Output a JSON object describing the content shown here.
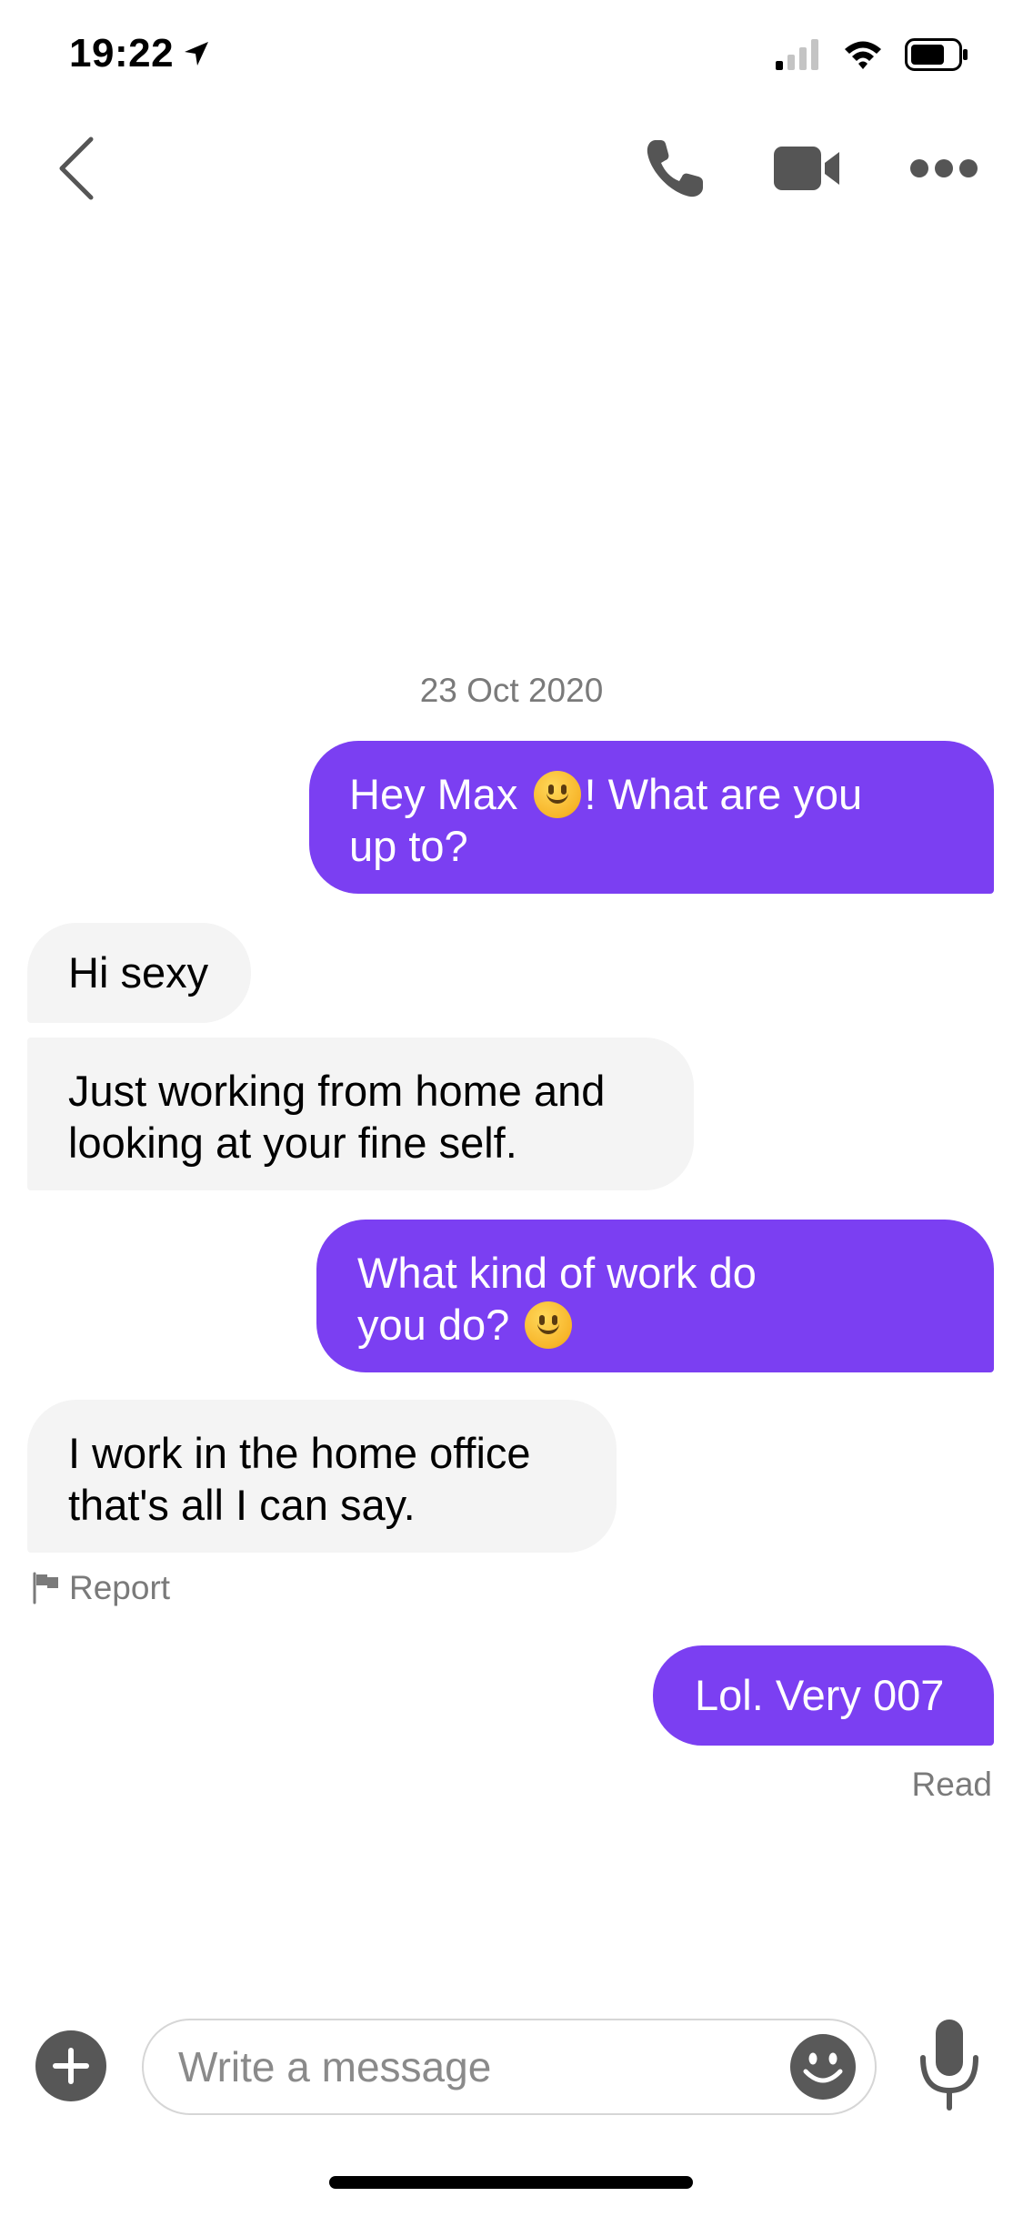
{
  "status_bar": {
    "time": "19:22"
  },
  "header": {
    "back_icon": "chevron-left-icon",
    "call_icon": "phone-icon",
    "video_icon": "video-camera-icon",
    "more_icon": "more-dots-icon"
  },
  "chat": {
    "date": "23 Oct 2020",
    "messages": [
      {
        "from": "me",
        "text_before_emoji": "Hey Max",
        "text_after_emoji": "! What are you",
        "line2": "up to?"
      },
      {
        "from": "them",
        "text": "Hi sexy"
      },
      {
        "from": "them",
        "line1": "Just working  from home and",
        "line2": "looking at your fine self."
      },
      {
        "from": "me",
        "line1": "What kind of work do",
        "line2": "you do?"
      },
      {
        "from": "them",
        "line1": "I work  in the home office",
        "line2": "that's all I can say."
      },
      {
        "from": "me",
        "text": "Lol. Very 007"
      }
    ],
    "report_label": "Report",
    "read_status": "Read"
  },
  "composer": {
    "placeholder": "Write a message",
    "value": "",
    "add_icon": "plus-circle-icon",
    "emoji_icon": "smiley-icon",
    "mic_icon": "microphone-icon"
  },
  "colors": {
    "accent": "#7b3ff2",
    "incoming": "#f4f4f4",
    "muted": "#7a7a7a"
  }
}
